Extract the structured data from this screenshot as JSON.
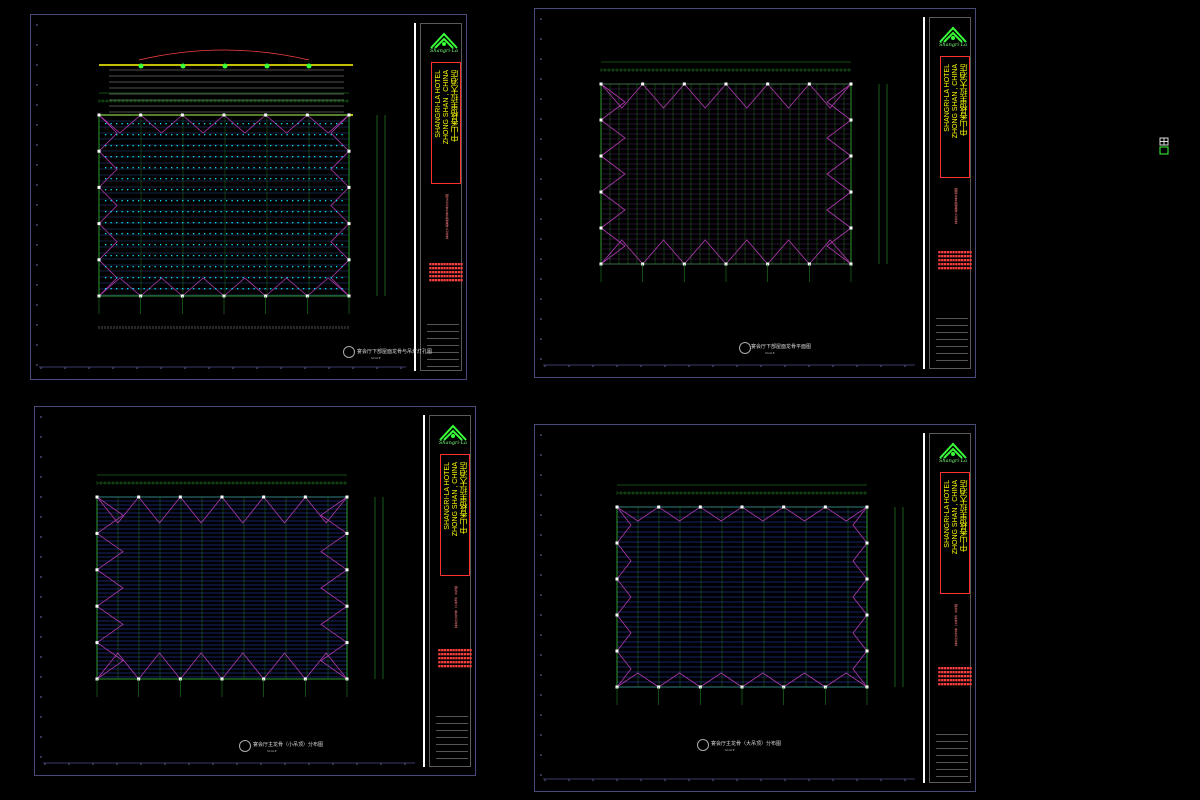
{
  "project": {
    "name_en_line1": "SHANGRI-LA  HOTEL",
    "name_en_line2": "ZHONG SHAN , CHINA",
    "name_cn": "中山香格里拉大酒店",
    "logo_text": "Shangri-La"
  },
  "sheets": [
    {
      "caption": "宴会厅下部屋面龙骨与吊灯灯孔图",
      "scale": "SCALE"
    },
    {
      "caption": "宴会厅下部屋面龙骨平面图",
      "scale": "SCALE"
    },
    {
      "caption": "宴会厅主龙骨（小吊顶）分布图",
      "scale": "SCALE"
    },
    {
      "caption": "宴会厅主龙骨（大吊顶）分布图",
      "scale": "SCALE"
    }
  ],
  "colors": {
    "background": "#000000",
    "frame": "#4a4a7a",
    "grid_green": "#2a9a2a",
    "brace_magenta": "#b03ab0",
    "beam_blue": "#3a5aff",
    "light_cyan": "#00e5ff",
    "title_yellow": "#ffff00",
    "note_red": "#ff3030"
  },
  "icons": [
    "shangri-la-logo-icon",
    "layout-tab-icon"
  ]
}
